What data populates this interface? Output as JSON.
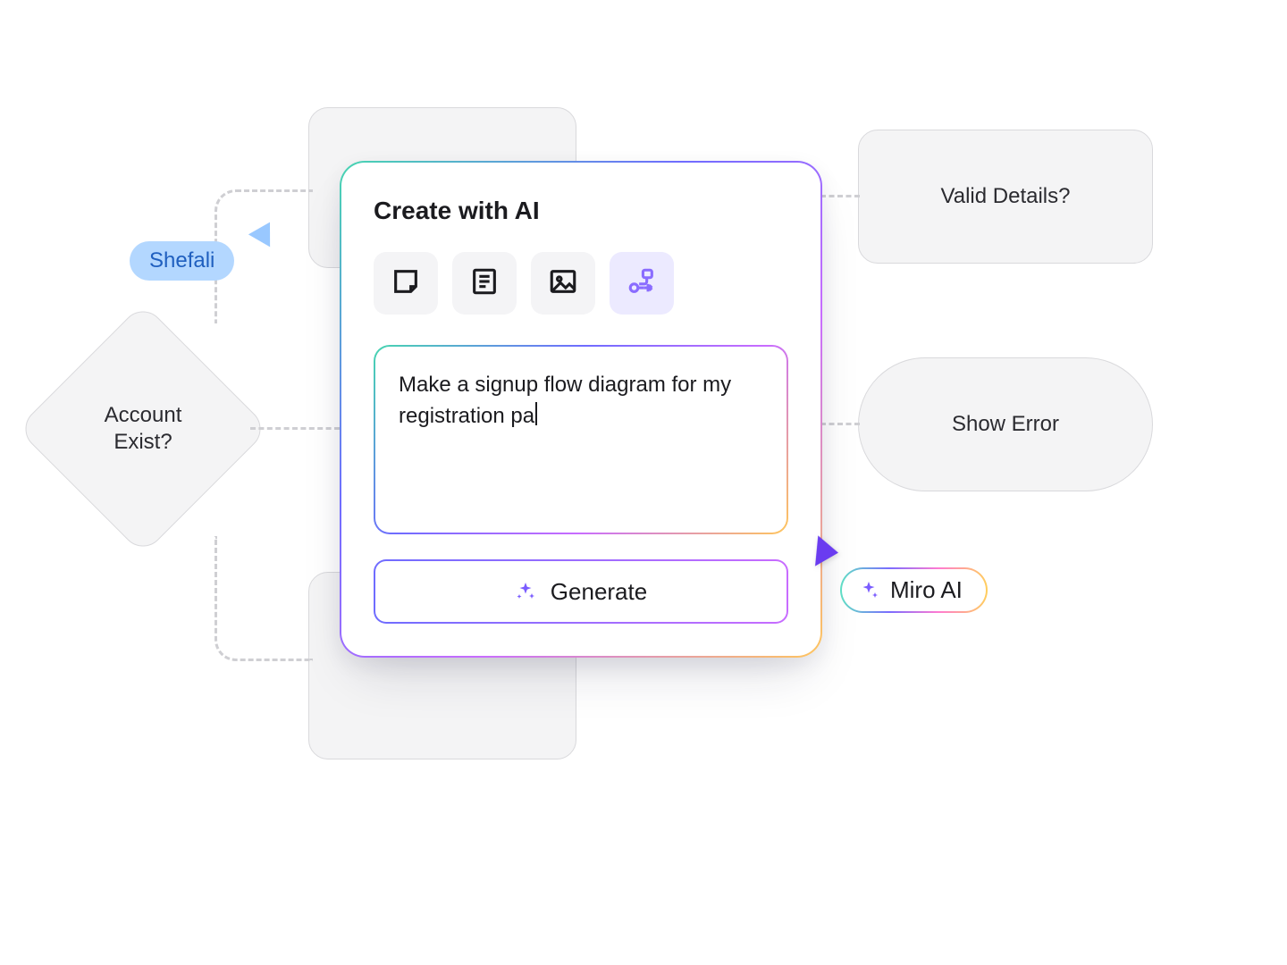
{
  "flow": {
    "decision_account": "Account\nExist?",
    "node_valid_details": "Valid Details?",
    "node_show_error": "Show Error"
  },
  "users": {
    "remote_user": "Shefali",
    "ai_cursor": "Miro AI"
  },
  "ai_panel": {
    "title": "Create with AI",
    "tools": {
      "sticky": "sticky-note",
      "doc": "document",
      "image": "image",
      "flow": "flowchart"
    },
    "prompt_text": "Make a signup flow diagram for my registration pa",
    "generate_label": "Generate"
  },
  "colors": {
    "node_fill": "#f4f4f5",
    "node_border": "#d9d9dc",
    "user_tag_bg": "#b3d7ff",
    "user_tag_text": "#1f5fbf",
    "accent_purple": "#7a5cff"
  }
}
